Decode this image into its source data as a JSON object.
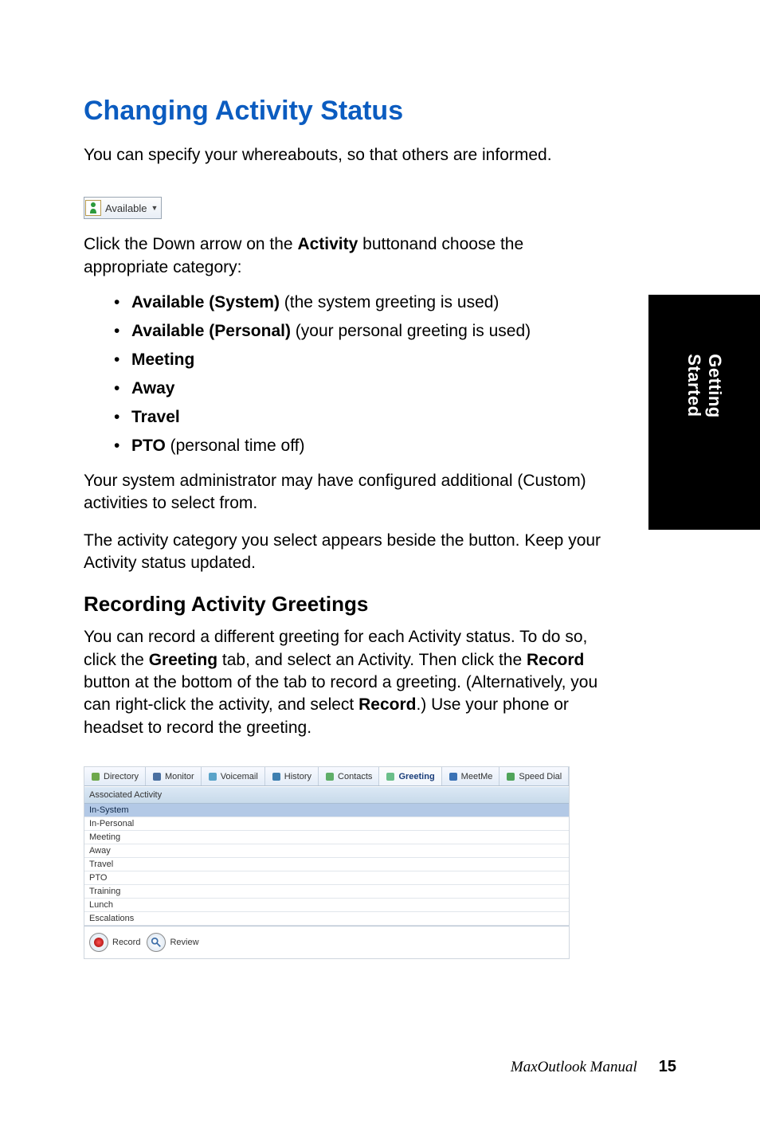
{
  "sideTab": "Getting Started",
  "title": "Changing Activity Status",
  "intro": "You can specify your whereabouts, so that others are informed.",
  "activityButton": {
    "label": "Available"
  },
  "paraBefore": {
    "p1": "Click the Down arrow on the ",
    "bold": "Activity",
    "p2": " buttonand choose the appropriate category:"
  },
  "options": [
    {
      "bold": "Available (System)",
      "rest": " (the system greeting is used)"
    },
    {
      "bold": "Available (Personal)",
      "rest": " (your personal greeting is used)"
    },
    {
      "bold": "Meeting",
      "rest": ""
    },
    {
      "bold": "Away",
      "rest": ""
    },
    {
      "bold": "Travel",
      "rest": ""
    },
    {
      "bold": "PTO",
      "rest": " (personal time off)"
    }
  ],
  "afterOptions1": "Your system administrator may have configured additional (Custom) activities to select from.",
  "afterOptions2": "The activity category you select appears beside the button. Keep your Activity status updated.",
  "subTitle": "Recording Activity Greetings",
  "recPara": {
    "t1": "You can record a different greeting for each Activity status. To do so, click the ",
    "b1": "Greeting",
    "t2": " tab, and select an Activity. Then click the ",
    "b2": "Record",
    "t3": " button at the bottom of the tab to record a greeting. (Alternatively, you can right-click the activity, and select ",
    "b3": "Record",
    "t4": ".) Use your phone or headset to record the greeting."
  },
  "tabs": [
    {
      "label": "Directory",
      "icon": "directory-icon",
      "color": "#6ea84c"
    },
    {
      "label": "Monitor",
      "icon": "monitor-icon",
      "color": "#4a6fa0"
    },
    {
      "label": "Voicemail",
      "icon": "voicemail-icon",
      "color": "#5aa3c9"
    },
    {
      "label": "History",
      "icon": "history-icon",
      "color": "#3e7fb0"
    },
    {
      "label": "Contacts",
      "icon": "contacts-icon",
      "color": "#5fae68"
    },
    {
      "label": "Greeting",
      "icon": "greeting-icon",
      "color": "#6bbf8a",
      "active": true
    },
    {
      "label": "MeetMe",
      "icon": "meetme-icon",
      "color": "#3b72b5"
    },
    {
      "label": "Speed Dial",
      "icon": "speeddial-icon",
      "color": "#50a45a"
    }
  ],
  "gridHeader": "Associated Activity",
  "gridRows": [
    {
      "label": "In-System",
      "selected": true
    },
    {
      "label": "In-Personal"
    },
    {
      "label": "Meeting"
    },
    {
      "label": "Away"
    },
    {
      "label": "Travel"
    },
    {
      "label": "PTO"
    },
    {
      "label": "Training"
    },
    {
      "label": "Lunch"
    },
    {
      "label": "Escalations"
    }
  ],
  "footerBtns": {
    "record": "Record",
    "review": "Review"
  },
  "footer": {
    "manual": "MaxOutlook Manual",
    "page": "15"
  }
}
